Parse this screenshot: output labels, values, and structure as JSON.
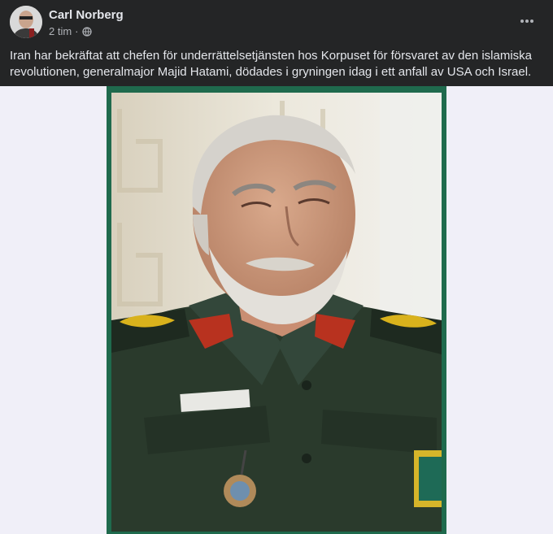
{
  "post": {
    "author": "Carl Norberg",
    "timestamp": "2 tim",
    "separator": "·",
    "privacy_icon": "globe-icon",
    "more_icon": "more-options-icon",
    "text": "Iran har bekräftat att chefen för underrättelsetjänsten hos Korpuset för försvaret av den islamiska revolutionen, generalmajor Majid Hatami, dödades i gryningen idag i ett anfall av USA och Israel."
  },
  "colors": {
    "header_bg": "#242526",
    "page_bg": "#f0eff8",
    "photo_border": "#1f6a4d",
    "uniform": "#2a3a2c"
  }
}
